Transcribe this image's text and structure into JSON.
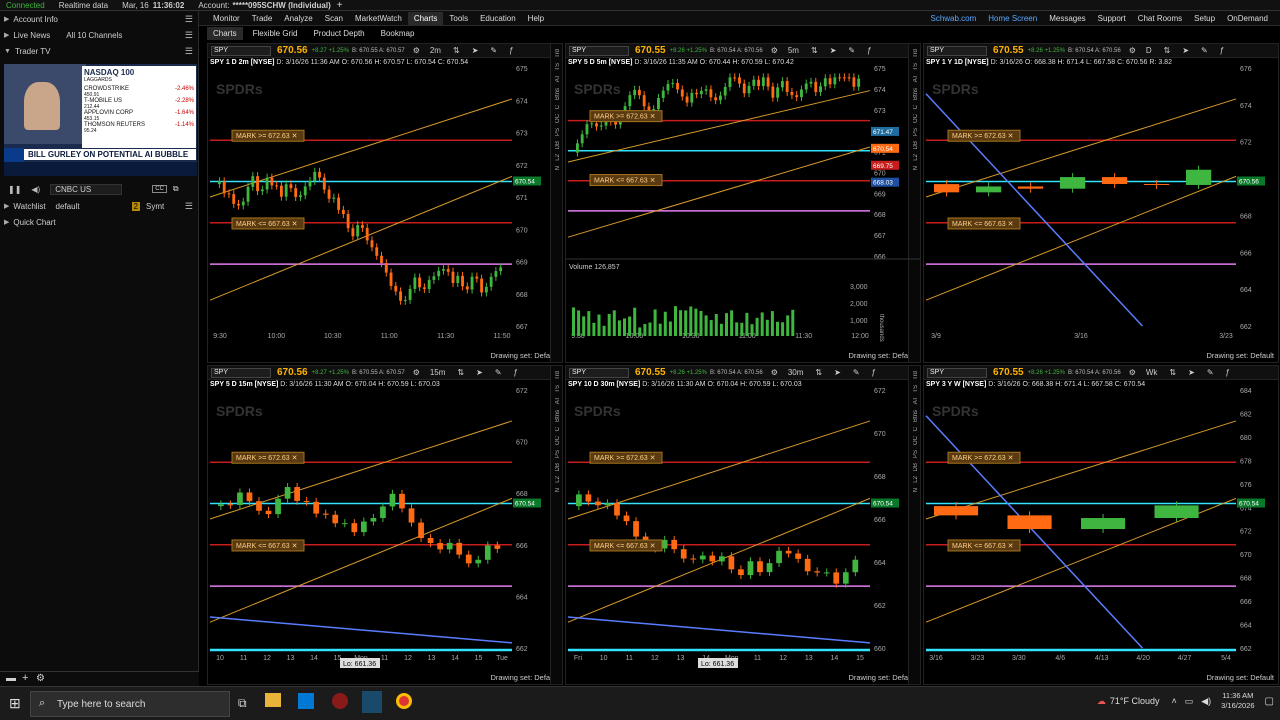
{
  "topbar": {
    "status": "Connected",
    "data_feed": "Realtime data",
    "datetime": "Mar, 16",
    "time": "11:36:02",
    "account_label": "Account:",
    "account": "*****095SCHW (Individual)"
  },
  "main_menu": [
    "Monitor",
    "Trade",
    "Analyze",
    "Scan",
    "MarketWatch",
    "Charts",
    "Tools",
    "Education",
    "Help"
  ],
  "right_menu": [
    "Schwab.com",
    "Home Screen",
    "Messages",
    "Support",
    "Chat Rooms",
    "Setup",
    "OnDemand"
  ],
  "sub_tabs": [
    "Charts",
    "Flexible Grid",
    "Product Depth",
    "Bookmap"
  ],
  "left_panel": {
    "account_info": "Account Info",
    "live_news": "Live News",
    "live_news_channels": "All 10 Channels",
    "trader_tv": "Trader TV",
    "tv_channel": "CNBC US",
    "tv_headline": "BILL GURLEY ON POTENTIAL AI BUBBLE",
    "tv_box_title": "NASDAQ 100",
    "tv_box_sub": "LAGGARDS",
    "tv_rows": [
      {
        "name": "CROWDSTRIKE",
        "price": "450.91",
        "chg": "-2.46%"
      },
      {
        "name": "T-MOBILE US",
        "price": "212.44",
        "chg": "-2.28%"
      },
      {
        "name": "APPLOVIN CORP",
        "price": "453.15",
        "chg": "-1.64%"
      },
      {
        "name": "THOMSON REUTERS",
        "price": "95.24",
        "chg": "-1.14%"
      }
    ],
    "watchlist": "Watchlist",
    "watchlist_value": "default",
    "symbol_label": "Symt",
    "quick_chart": "Quick Chart"
  },
  "charts": [
    {
      "symbol": "SPY",
      "price": "670.56",
      "chg": "+8.27 +1.25%",
      "bidask": "B: 670.55 A: 670.57",
      "tf": "2m",
      "title": "SPY 1 D 2m [NYSE]",
      "ohlc": "D: 3/16/26 11:36 AM  O: 670.56  H: 670.57  L: 670.54  C: 670.54",
      "xlabels": [
        "9:30",
        "10:00",
        "10:30",
        "11:00",
        "11:30",
        "11:50"
      ],
      "ylabels": [
        "675",
        "674",
        "673",
        "672",
        "671",
        "670",
        "669",
        "668",
        "667"
      ],
      "mark_hi": "MARK >= 672.63",
      "mark_lo": "MARK <= 667.63",
      "last": "670.54"
    },
    {
      "symbol": "SPY",
      "price": "670.55",
      "chg": "+8.26 +1.25%",
      "bidask": "B: 670.54 A: 670.56",
      "tf": "5m",
      "title": "SPY 5 D 5m [NYSE]",
      "ohlc": "D: 3/16/26 11:35 AM  O: 670.44  H: 670.59  L: 670.42",
      "xlabels": [
        "9:30",
        "10:00",
        "10:30",
        "11:00",
        "11:30",
        "12:00"
      ],
      "ylabels": [
        "675",
        "674",
        "673",
        "672",
        "671",
        "670",
        "669",
        "668",
        "667",
        "666"
      ],
      "mark_hi": "MARK >= 672.63",
      "mark_lo": "MARK <= 667.63",
      "levels": [
        "671.47",
        "670.54",
        "669.75",
        "668.03"
      ],
      "volume_label": "Volume",
      "volume": "126,857",
      "vol_ticks": [
        "3,000",
        "2,000",
        "1,000"
      ],
      "vol_unit": "thousands"
    },
    {
      "symbol": "SPY",
      "price": "670.55",
      "chg": "+8.26 +1.25%",
      "bidask": "B: 670.54 A: 670.56",
      "tf": "D",
      "title": "SPY 1 Y 1D [NYSE]",
      "ohlc": "D: 3/16/26  O: 668.38  H: 671.4  L: 667.58  C: 670.56  R: 3.82",
      "xlabels": [
        "3/9",
        "3/16",
        "3/23"
      ],
      "ylabels": [
        "676",
        "674",
        "672",
        "670",
        "668",
        "666",
        "664",
        "662"
      ],
      "mark_hi": "MARK >= 672.63",
      "mark_lo": "MARK <= 667.63",
      "last": "670.56"
    },
    {
      "symbol": "SPY",
      "price": "670.56",
      "chg": "+8.27 +1.25%",
      "bidask": "B: 670.55 A: 670.57",
      "tf": "15m",
      "title": "SPY 5 D 15m [NYSE]",
      "ohlc": "D: 3/16/26 11:30 AM  O: 670.04  H: 670.59  L: 670.03",
      "xlabels": [
        "10",
        "11",
        "12",
        "13",
        "14",
        "15",
        "Mon",
        "11",
        "12",
        "13",
        "14",
        "15",
        "Tue"
      ],
      "ylabels": [
        "672",
        "670",
        "668",
        "666",
        "664",
        "662"
      ],
      "mark_hi": "MARK >= 672.63",
      "mark_lo": "MARK <= 667.63",
      "low": "Lo: 661.36",
      "last": "670.54"
    },
    {
      "symbol": "SPY",
      "price": "670.55",
      "chg": "+8.26 +1.25%",
      "bidask": "B: 670.54 A: 670.56",
      "tf": "30m",
      "title": "SPY 10 D 30m [NYSE]",
      "ohlc": "D: 3/16/26 11:30 AM  O: 670.04  H: 670.59  L: 670.03",
      "xlabels": [
        "Fri",
        "10",
        "11",
        "12",
        "13",
        "14",
        "Mon",
        "11",
        "12",
        "13",
        "14",
        "15"
      ],
      "ylabels": [
        "672",
        "670",
        "668",
        "666",
        "664",
        "662",
        "660"
      ],
      "mark_hi": "MARK >= 672.63",
      "mark_lo": "MARK <= 667.63",
      "low": "Lo: 661.36",
      "last": "670.54"
    },
    {
      "symbol": "SPY",
      "price": "670.55",
      "chg": "+8.26 +1.25%",
      "bidask": "B: 670.54 A: 670.56",
      "tf": "Wk",
      "title": "SPY 3 Y W [NYSE]",
      "ohlc": "D: 3/16/26  O: 668.38  H: 671.4  L: 667.58  C: 670.54",
      "xlabels": [
        "3/16",
        "3/23",
        "3/30",
        "4/6",
        "4/13",
        "4/20",
        "4/27",
        "5/4"
      ],
      "ylabels": [
        "684",
        "682",
        "680",
        "678",
        "676",
        "674",
        "672",
        "670",
        "668",
        "666",
        "664",
        "662"
      ],
      "mark_hi": "MARK >= 672.63",
      "mark_lo": "MARK <= 667.63",
      "last": "670.54"
    }
  ],
  "drawing_set": "Drawing set: Default",
  "side_strip": [
    "Trd",
    "TS",
    "AT",
    "Btns",
    "C",
    "OC",
    "PS",
    "DB",
    "L2",
    "N"
  ],
  "taskbar": {
    "search_placeholder": "Type here to search",
    "weather": "71°F  Cloudy",
    "time": "11:36 AM",
    "date": "3/16/2026"
  },
  "colors": {
    "accent": "#ffb200",
    "up": "#3fb63f",
    "down": "#ff6a13",
    "cyan": "#31e3ff",
    "red": "#c81d1d",
    "magenta": "#e27ef0"
  }
}
